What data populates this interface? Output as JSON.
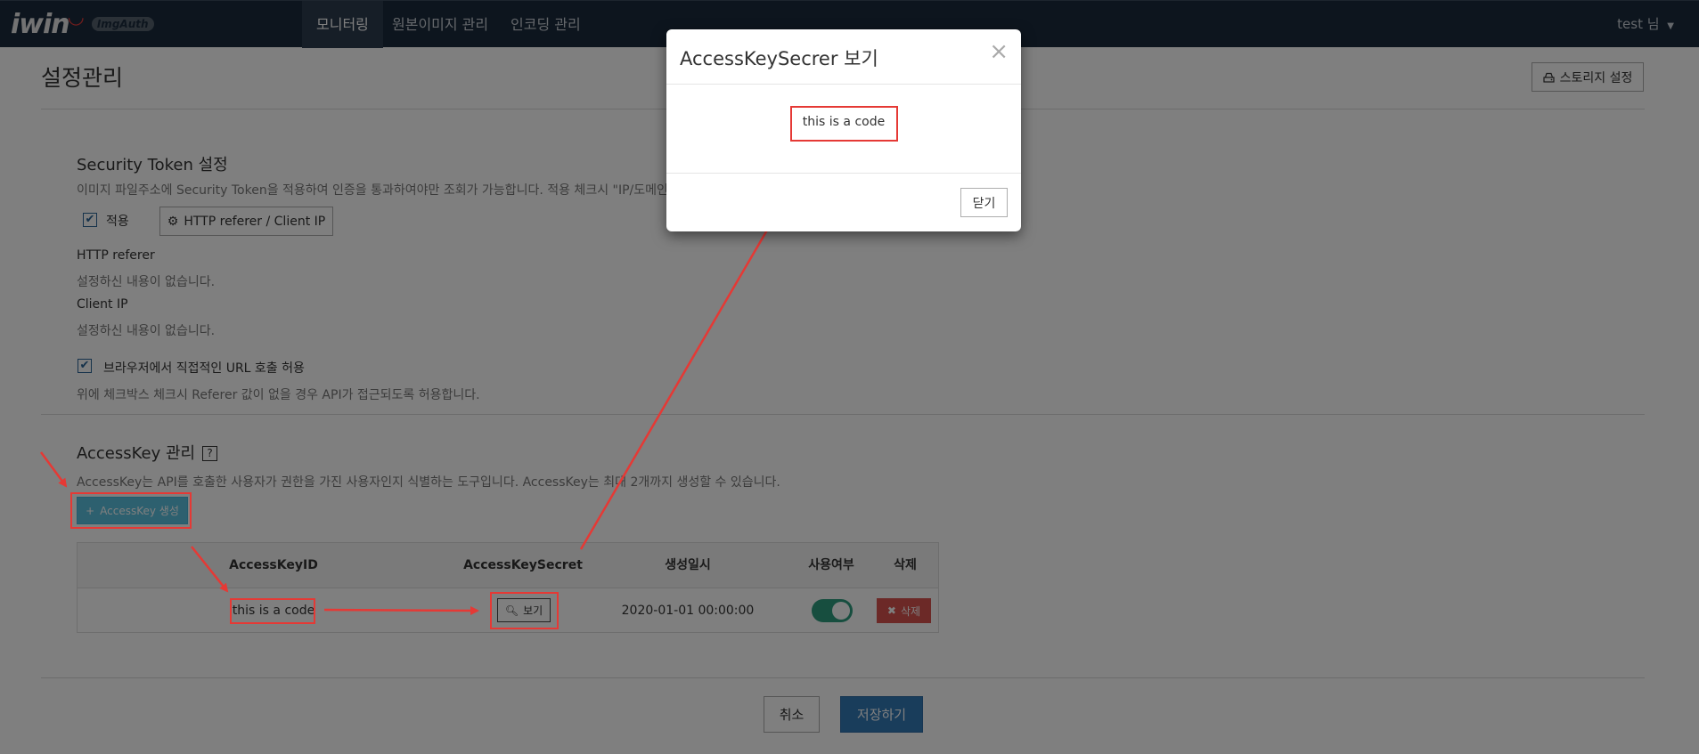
{
  "nav": {
    "logo": "iwin",
    "logo_badge": "ImgAuth",
    "items": [
      {
        "label": "모니터링",
        "active": true
      },
      {
        "label": "원본이미지 관리",
        "active": false
      },
      {
        "label": "인코딩 관리",
        "active": false
      }
    ],
    "user": "test 님"
  },
  "page": {
    "title": "설정관리",
    "storage_button": "스토리지 설정"
  },
  "security": {
    "title": "Security Token 설정",
    "description": "이미지 파일주소에 Security Token을 적용하여 인증을 통과하여야만 조회가 가능합니다. 적용 체크시 \"IP/도메인",
    "apply_label": "적용",
    "apply_checked": true,
    "http_button": "HTTP referer / Client IP",
    "http_referer_label": "HTTP referer",
    "http_referer_value": "설정하신 내용이 없습니다.",
    "client_ip_label": "Client IP",
    "client_ip_value": "설정하신 내용이 없습니다.",
    "browser_label": "브라우저에서 직접적인 URL 호출 허용",
    "browser_checked": true,
    "browser_help": "위에 체크박스 체크시 Referer 값이 없을 경우 API가 접근되도록 허용합니다."
  },
  "accesskey": {
    "title": "AccessKey 관리",
    "help_badge": "?",
    "description": "AccessKey는 API를 호출한 사용자가 권한을 가진 사용자인지 식별하는 도구입니다. AccessKey는 최대 2개까지 생성할 수 있습니다.",
    "generate_button": "AccessKey 생성",
    "columns": [
      "AccessKeyID",
      "AccessKeySecret",
      "생성일시",
      "사용여부",
      "삭제"
    ],
    "rows": [
      {
        "id": "this is a code",
        "secret_button": "보기",
        "created": "2020-01-01 00:00:00",
        "enabled": true,
        "delete_button": "삭제"
      }
    ]
  },
  "footer": {
    "cancel": "취소",
    "save": "저장하기"
  },
  "modal": {
    "title": "AccessKeySecrer 보기",
    "code": "this is a code",
    "close_button": "닫기"
  },
  "colors": {
    "nav_bg": "#1b2b3c",
    "primary": "#337ab7",
    "info": "#5bc0de",
    "danger": "#d9534f",
    "toggle_on": "#2e9d7f",
    "annotation": "#e53935"
  }
}
